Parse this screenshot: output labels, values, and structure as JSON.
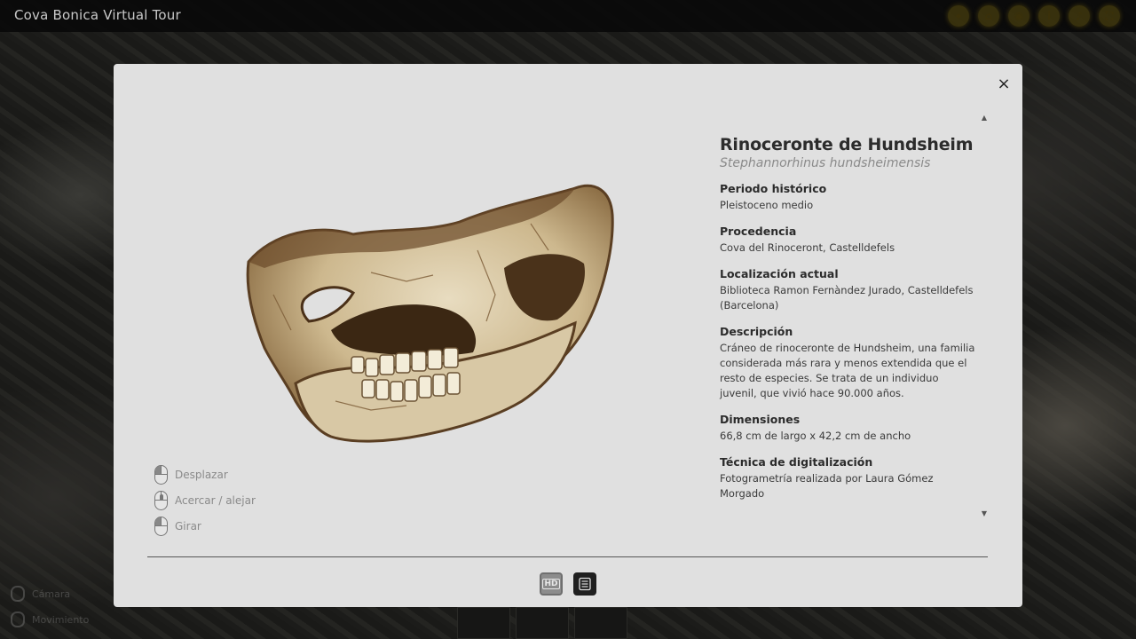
{
  "app": {
    "title": "Cova Bonica Virtual Tour"
  },
  "top_icons": [
    "map-icon",
    "home-icon",
    "location-pin-icon",
    "info-icon",
    "volume-icon",
    "fullscreen-icon"
  ],
  "background_hints": {
    "camera_label": "Cámara",
    "movement_label": "Movimiento"
  },
  "modal": {
    "close_label": "×",
    "controls": [
      {
        "label": "Desplazar",
        "icon": "mouse-left-click-icon"
      },
      {
        "label": "Acercar / alejar",
        "icon": "mouse-wheel-icon"
      },
      {
        "label": "Girar",
        "icon": "mouse-left-drag-icon"
      }
    ],
    "info": {
      "title": "Rinoceronte de Hundsheim",
      "subtitle": "Stephannorhinus hundsheimensis",
      "fields": [
        {
          "label": "Periodo histórico",
          "value": "Pleistoceno medio"
        },
        {
          "label": "Procedencia",
          "value": "Cova del Rinoceront, Castelldefels"
        },
        {
          "label": "Localización actual",
          "value": "Biblioteca Ramon Fernàndez Jurado, Castelldefels (Barcelona)"
        },
        {
          "label": "Descripción",
          "value": "Cráneo de rinoceronte de Hundsheim, una familia considerada más rara y menos extendida que el resto de especies. Se trata de un individuo juvenil, que vivió hace 90.000 años."
        },
        {
          "label": "Dimensiones",
          "value": "66,8 cm de largo x 42,2 cm de ancho"
        },
        {
          "label": "Técnica de digitalización",
          "value": "Fotogrametría realizada por Laura Gómez Morgado"
        }
      ]
    },
    "bottom_buttons": {
      "hd_label": "HD",
      "doc_icon": "document-icon"
    }
  },
  "colors": {
    "modal_bg": "#e0e0e0",
    "topbar_icon": "#8c7814",
    "doc_button": "#1f1f1f"
  }
}
